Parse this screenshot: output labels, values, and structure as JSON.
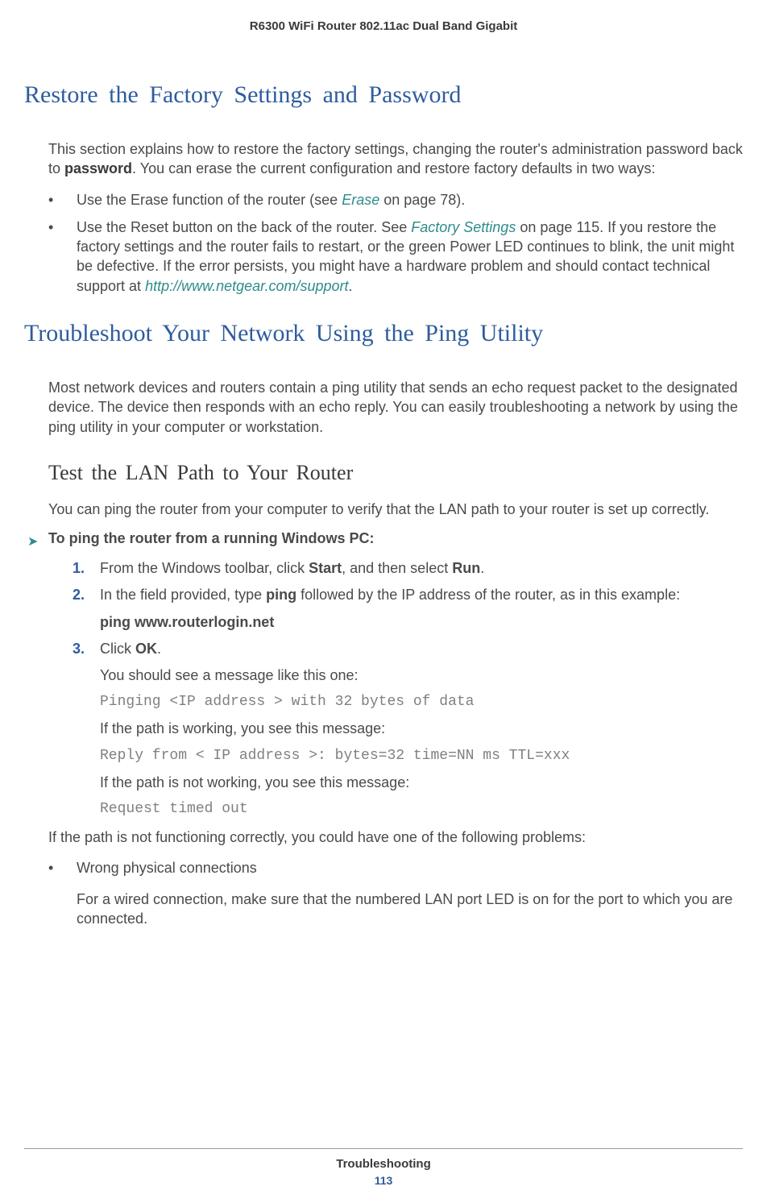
{
  "header": {
    "title": "R6300 WiFi Router 802.11ac Dual Band Gigabit"
  },
  "section1": {
    "title": "Restore  the  Factory  Settings and  Password",
    "intro_pre": "This section explains how to restore the factory settings, changing the router's administration password back to ",
    "intro_bold": "password",
    "intro_post": ". You can erase the current configuration and restore factory defaults in two ways:",
    "bullet1_pre": "Use the Erase function of the router (see ",
    "bullet1_link": "Erase",
    "bullet1_post": " on page 78).",
    "bullet2_pre": "Use the Reset button on the back of the router. See ",
    "bullet2_link1": "Factory Settings",
    "bullet2_mid": " on page 115. If you restore the factory settings and the router fails to restart, or the green Power LED continues to blink, the unit might be defective. If the error persists, you might have a hardware problem and should contact technical support at ",
    "bullet2_link2": "http://www.netgear.com/support",
    "bullet2_post": "."
  },
  "section2": {
    "title": "Troubleshoot Your Network Using  the  Ping  Utility",
    "intro": "Most network devices and routers contain a ping utility that sends an echo request packet to the designated device. The device then responds with an echo reply. You can easily troubleshooting a network by using the ping utility in your computer or workstation.",
    "sub_title": "Test the  LAN Path  to  Your Router",
    "sub_intro": "You can ping the router from your computer to verify that the LAN path to your router is set up correctly.",
    "proc_title": "To ping the router from a running Windows PC:",
    "step1_pre": "From the Windows toolbar, click ",
    "step1_b1": "Start",
    "step1_mid": ", and then select ",
    "step1_b2": "Run",
    "step1_post": ".",
    "step2_pre": "In the field provided, type ",
    "step2_b": "ping",
    "step2_post": " followed by the IP address of the router, as in this example:",
    "step2_example": "ping www.routerlogin.net",
    "step3_pre": "Click ",
    "step3_b": "OK",
    "step3_post": ".",
    "step3_t1": "You should see a message like this one:",
    "step3_code1": "Pinging <IP address > with 32 bytes of data",
    "step3_t2": "If the path is working, you see this message:",
    "step3_code2": "Reply from < IP address >: bytes=32 time=NN ms TTL=xxx",
    "step3_t3": "If the path is not working, you see this message:",
    "step3_code3": "Request timed out",
    "problems_intro": "If the path is not functioning correctly, you could have one of the following problems:",
    "prob1_title": "Wrong physical connections",
    "prob1_text": "For a wired connection, make sure that the numbered LAN port LED is on for the port to which you are connected."
  },
  "footer": {
    "chapter": "Troubleshooting",
    "page": "113"
  }
}
